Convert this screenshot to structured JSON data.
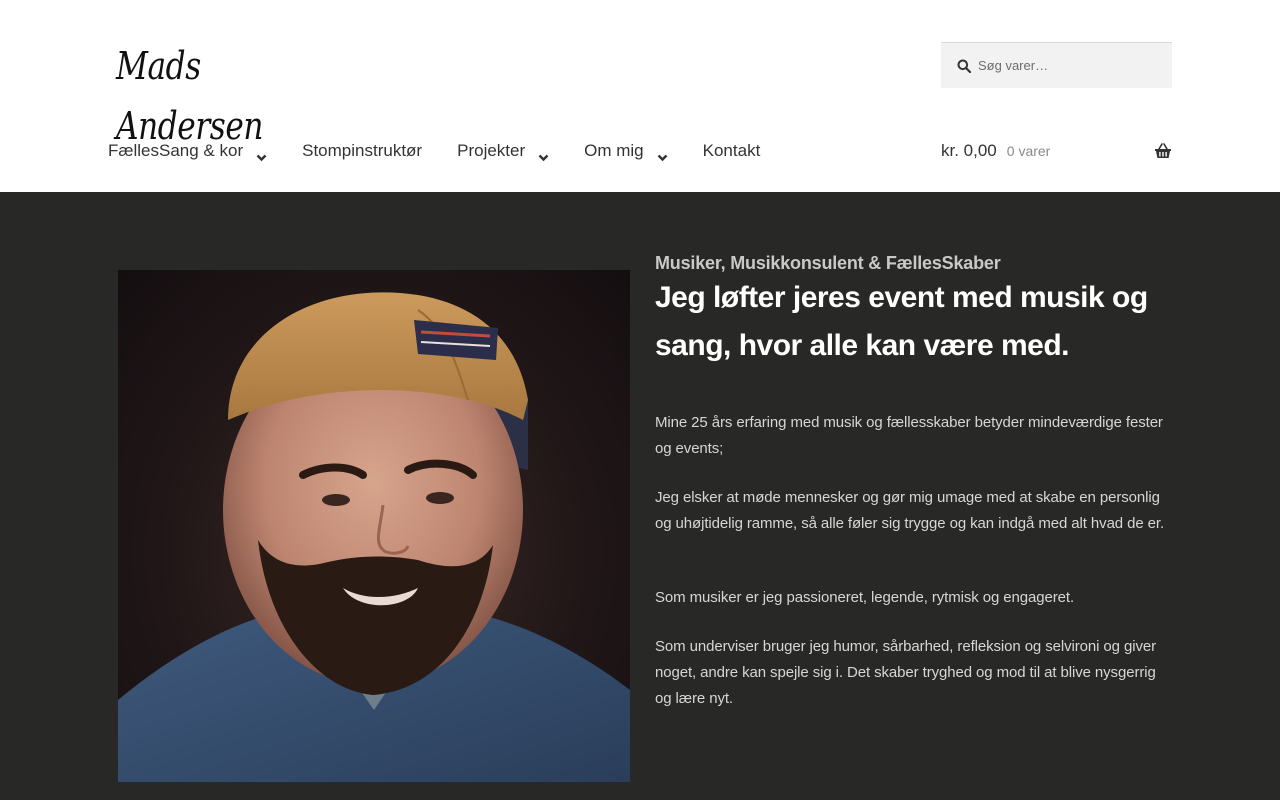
{
  "header": {
    "logo_text": "Mads Andersen",
    "search": {
      "placeholder": "Søg varer…",
      "value": ""
    },
    "nav": [
      {
        "label": "FællesSang & kor",
        "has_dropdown": true
      },
      {
        "label": "Stompinstruktør",
        "has_dropdown": false
      },
      {
        "label": "Projekter",
        "has_dropdown": true
      },
      {
        "label": "Om mig",
        "has_dropdown": true
      },
      {
        "label": "Kontakt",
        "has_dropdown": false
      }
    ],
    "cart": {
      "amount": "kr. 0,00",
      "count": "0 varer",
      "icon": "basket-icon"
    }
  },
  "hero": {
    "subtitle": "Musiker, Musikkonsulent & FællesSkaber",
    "headline": "Jeg løfter jeres event med musik og sang, hvor alle kan være med.",
    "paragraphs": [
      "Mine 25 års erfaring med musik og fællesskaber betyder mindeværdige fester og events;",
      "Jeg elsker at møde mennesker og gør mig umage med at skabe en personlig og uhøjtidelig ramme, så alle føler sig trygge og kan indgå med alt hvad de er.",
      "Som musiker er jeg passioneret, legende, rytmisk og engageret.",
      "Som underviser bruger jeg humor, sårbarhed, refleksion og selvironi og giver noget, andre kan spejle sig i. Det skaber tryghed og mod til at blive nysgerrig og lære nyt."
    ]
  },
  "colors": {
    "hero_background": "#282826",
    "header_background": "#ffffff",
    "search_background": "#f2f2f2"
  }
}
